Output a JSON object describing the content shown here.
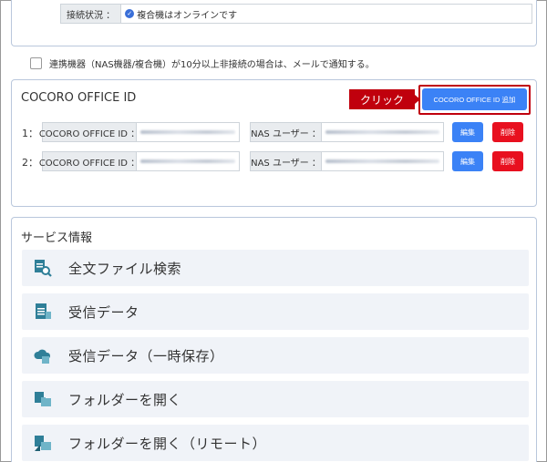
{
  "connection": {
    "label": "接続状況 ：",
    "status": "複合機はオンラインです"
  },
  "notify": {
    "text": "連携機器（NAS機器/複合機）が10分以上非接続の場合は、メールで通知する。",
    "checked": false
  },
  "cocoro": {
    "title": "COCORO OFFICE ID",
    "callout": "クリック",
    "add_button": "COCORO OFFICE ID 追加",
    "rows": [
      {
        "num": "1：",
        "id_label": "COCORO OFFICE ID ：",
        "nas_label": "NAS ユーザー ：",
        "edit": "編集",
        "delete": "削除"
      },
      {
        "num": "2：",
        "id_label": "COCORO OFFICE ID ：",
        "nas_label": "NAS ユーザー ：",
        "edit": "編集",
        "delete": "削除"
      }
    ]
  },
  "services": {
    "title": "サービス情報",
    "items": [
      {
        "label": "全文ファイル検索",
        "icon": "file-search-icon"
      },
      {
        "label": "受信データ",
        "icon": "document-icon"
      },
      {
        "label": "受信データ（一時保存）",
        "icon": "cloud-icon"
      },
      {
        "label": "フォルダーを開く",
        "icon": "folder-open-icon"
      },
      {
        "label": "フォルダーを開く（リモート）",
        "icon": "remote-folder-icon"
      }
    ]
  },
  "colors": {
    "primary": "#3b82f6",
    "danger": "#e8101f",
    "callout": "#c0000d",
    "icon_teal": "#2f7f98"
  }
}
